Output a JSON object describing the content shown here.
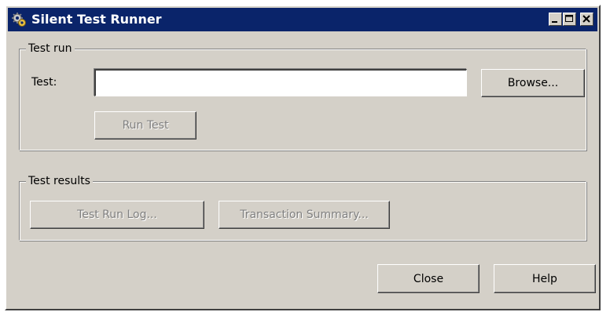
{
  "window": {
    "title": "Silent Test Runner",
    "app_icon": "gears-icon",
    "controls": [
      "minimize-icon",
      "maximize-icon",
      "close-icon"
    ]
  },
  "test_run": {
    "group_label": "Test run",
    "test_label": "Test:",
    "test_value": "",
    "browse_label": "Browse...",
    "run_test_label": "Run Test",
    "run_test_enabled": false
  },
  "test_results": {
    "group_label": "Test results",
    "log_label": "Test Run Log...",
    "log_enabled": false,
    "summary_label": "Transaction Summary...",
    "summary_enabled": false
  },
  "footer": {
    "close_label": "Close",
    "help_label": "Help"
  },
  "colors": {
    "title_bar": "#0a246a",
    "face": "#d4d0c8",
    "disabled_text": "#808080"
  }
}
